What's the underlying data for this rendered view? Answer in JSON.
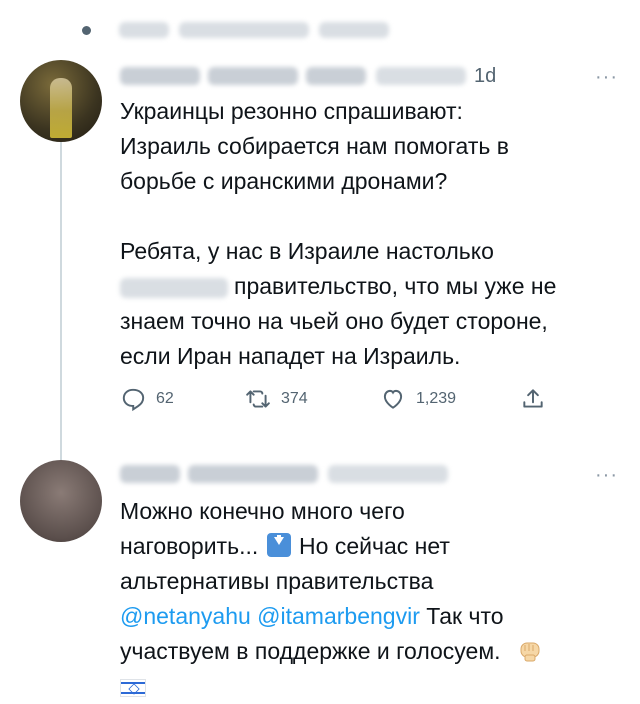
{
  "tweet1": {
    "time": "1d",
    "more": "···",
    "paragraph1": [
      "Украинцы резонно спрашивают:",
      "Израиль собирается нам помогать в",
      "борьбе с иранскими дронами?"
    ],
    "paragraph2_line1": "Ребята, у нас в Израиле настолько",
    "paragraph2_line2_suffix": "правительство, что мы уже не",
    "paragraph2_rest": [
      "знаем точно на чьей оно будет стороне,",
      "если Иран нападет на Израиль."
    ],
    "actions": {
      "replies": "62",
      "retweets": "374",
      "likes": "1,239"
    }
  },
  "tweet2": {
    "more": "···",
    "line1": "Можно конечно много чего",
    "line2_before": "наговорить...",
    "line2_after": "Но сейчас нет",
    "line3": "альтернативы правительства",
    "mention1": "@netanyahu",
    "mention2": "@itamarbengvir",
    "line4_after": "Так что",
    "line5": "участвуем в поддержке и голосуем.",
    "icons": [
      "down-arrow-emoji-icon",
      "fist-emoji-icon",
      "israel-flag-emoji-icon"
    ]
  },
  "colors": {
    "link": "#1d9bf0",
    "muted": "#536471",
    "text": "#0f1419"
  }
}
